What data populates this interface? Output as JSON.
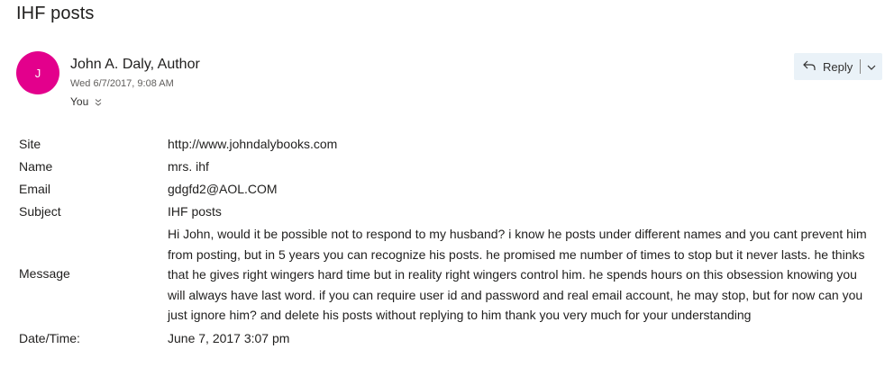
{
  "subject": "IHF posts",
  "sender": {
    "initial": "J",
    "name": "John A. Daly, Author",
    "date": "Wed 6/7/2017, 9:08 AM",
    "recipients": "You",
    "avatar_color": "#e3008c"
  },
  "actions": {
    "reply_label": "Reply",
    "reply_icon": "reply-arrow-icon",
    "more_icon": "chevron-down-icon"
  },
  "fields": {
    "site": {
      "label": "Site",
      "value": "http://www.johndalybooks.com"
    },
    "name": {
      "label": "Name",
      "value": "mrs. ihf"
    },
    "email": {
      "label": "Email",
      "value": "gdgfd2@AOL.COM"
    },
    "subject": {
      "label": "Subject",
      "value": "IHF posts"
    },
    "message": {
      "label": "Message",
      "value": "Hi John, would it be possible not to respond to my husband? i know he posts under different names and you cant prevent him from posting, but in 5 years you can recognize his posts. he promised me number of times to stop but it never lasts. he thinks that he gives right wingers hard time but in reality right wingers control him. he spends hours on this obsession knowing you will always have last word. if you can require user id and password and real email account, he may stop, but for now can you just ignore him? and delete his posts without replying to him thank you very much for your understanding"
    },
    "datetime": {
      "label": "Date/Time:",
      "value": "June 7, 2017 3:07 pm"
    }
  }
}
